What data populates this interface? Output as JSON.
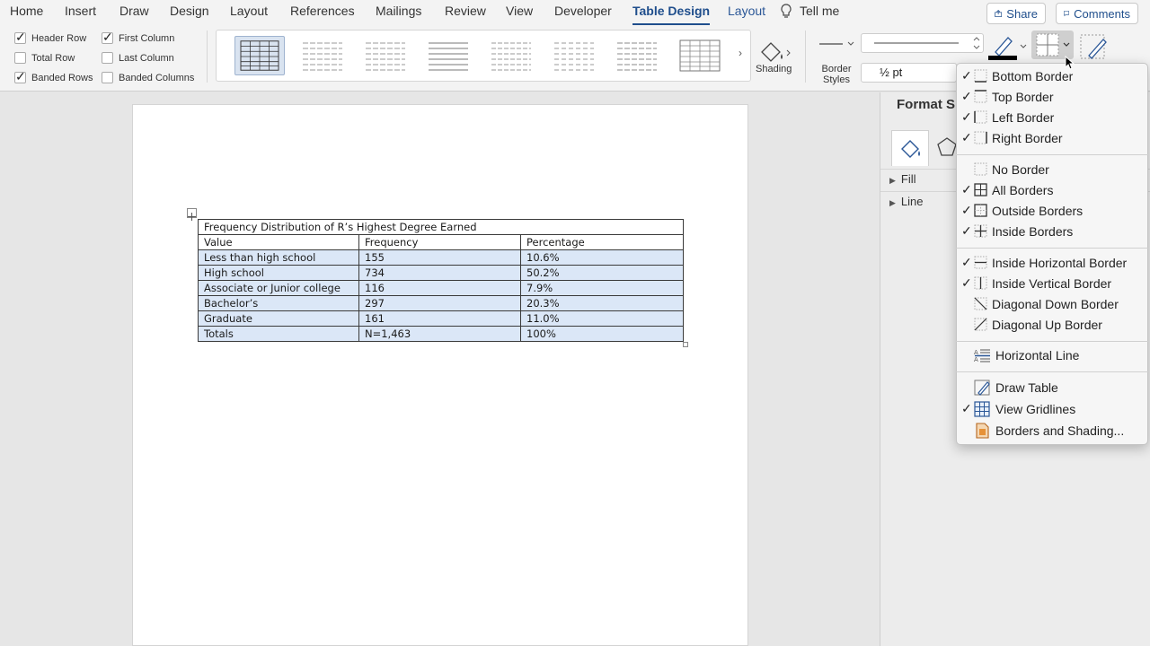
{
  "menu": {
    "tabs": [
      "Home",
      "Insert",
      "Draw",
      "Design",
      "Layout",
      "References",
      "Mailings",
      "Review",
      "View",
      "Developer",
      "Table Design",
      "Layout"
    ],
    "tell_me": "Tell me",
    "share": "Share",
    "comments": "Comments"
  },
  "ribbon": {
    "options": [
      {
        "label": "Header Row",
        "checked": true
      },
      {
        "label": "Total Row",
        "checked": false
      },
      {
        "label": "Banded Rows",
        "checked": true
      },
      {
        "label": "First Column",
        "checked": true
      },
      {
        "label": "Last Column",
        "checked": false
      },
      {
        "label": "Banded Columns",
        "checked": false
      }
    ],
    "shading_label": "Shading",
    "border_styles_label": "Border Styles",
    "line_weight": "½ pt",
    "pen_color": "#000000"
  },
  "table": {
    "title": "Frequency Distribution of R’s Highest Degree Earned",
    "headers": [
      "Value",
      "Frequency",
      "Percentage"
    ],
    "rows": [
      [
        "Less than high school",
        "155",
        "10.6%"
      ],
      [
        "High school",
        "734",
        "50.2%"
      ],
      [
        "Associate or Junior college",
        "116",
        "7.9%"
      ],
      [
        "Bachelor’s",
        "297",
        "20.3%"
      ],
      [
        "Graduate",
        "161",
        "11.0%"
      ],
      [
        "Totals",
        "N=1,463",
        "100%"
      ]
    ],
    "band_color": "#dbe7f7"
  },
  "pane": {
    "title": "Format Sl",
    "sections": [
      "Fill",
      "Line"
    ]
  },
  "borders_menu": {
    "items": [
      {
        "label": "Bottom Border",
        "checked": true,
        "icon": "bottom-border-icon"
      },
      {
        "label": "Top Border",
        "checked": true,
        "icon": "top-border-icon"
      },
      {
        "label": "Left Border",
        "checked": true,
        "icon": "left-border-icon"
      },
      {
        "label": "Right Border",
        "checked": true,
        "icon": "right-border-icon"
      },
      {
        "label": "No Border",
        "checked": false,
        "icon": "no-border-icon"
      },
      {
        "label": "All Borders",
        "checked": true,
        "icon": "all-borders-icon"
      },
      {
        "label": "Outside Borders",
        "checked": true,
        "icon": "outside-borders-icon"
      },
      {
        "label": "Inside Borders",
        "checked": true,
        "icon": "inside-borders-icon"
      },
      {
        "label": "Inside Horizontal Border",
        "checked": true,
        "icon": "inside-horizontal-border-icon"
      },
      {
        "label": "Inside Vertical Border",
        "checked": true,
        "icon": "inside-vertical-border-icon"
      },
      {
        "label": "Diagonal Down Border",
        "checked": false,
        "icon": "diagonal-down-border-icon"
      },
      {
        "label": "Diagonal Up Border",
        "checked": false,
        "icon": "diagonal-up-border-icon"
      },
      {
        "label": "Horizontal Line",
        "checked": false,
        "icon": "horizontal-line-icon"
      },
      {
        "label": "Draw Table",
        "checked": false,
        "icon": "draw-table-icon"
      },
      {
        "label": "View Gridlines",
        "checked": true,
        "icon": "view-gridlines-icon"
      },
      {
        "label": "Borders and Shading...",
        "checked": false,
        "icon": "borders-shading-icon"
      }
    ]
  },
  "colors": {
    "accent": "#1f4e8c",
    "ribbon_bg": "#f3f3f3"
  }
}
